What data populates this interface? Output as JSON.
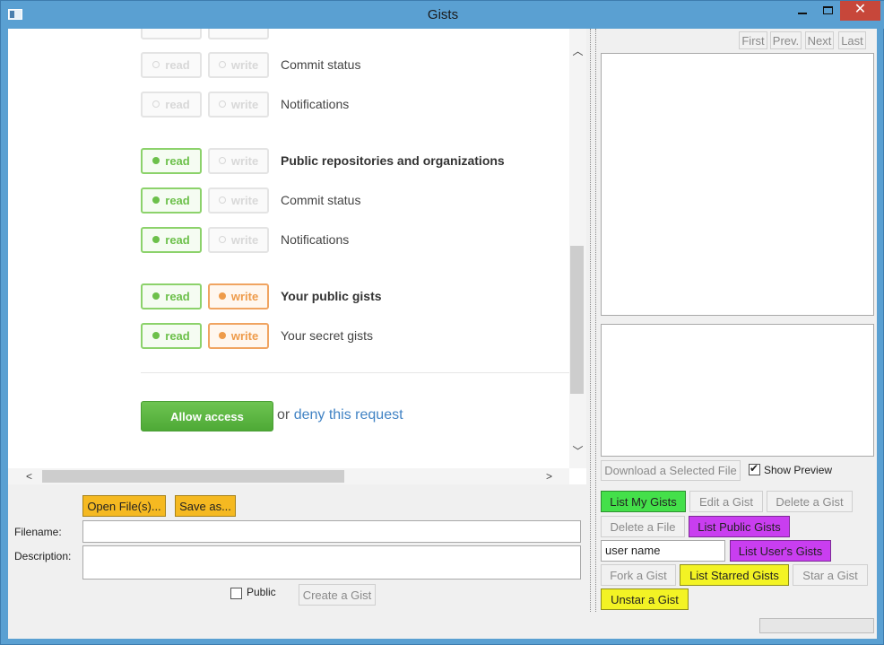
{
  "window": {
    "title": "Gists",
    "close_glyph": "✕"
  },
  "permissions": [
    {
      "read": "read",
      "write": "write",
      "read_on": false,
      "write_on": false,
      "label": "Commit status",
      "bold": false
    },
    {
      "read": "read",
      "write": "write",
      "read_on": false,
      "write_on": false,
      "label": "Notifications",
      "bold": false
    },
    {
      "read": "read",
      "write": "write",
      "read_on": true,
      "write_on": false,
      "label": "Public repositories and organizations",
      "bold": true
    },
    {
      "read": "read",
      "write": "write",
      "read_on": true,
      "write_on": false,
      "label": "Commit status",
      "bold": false
    },
    {
      "read": "read",
      "write": "write",
      "read_on": true,
      "write_on": false,
      "label": "Notifications",
      "bold": false
    },
    {
      "read": "read",
      "write": "write",
      "read_on": true,
      "write_on": true,
      "label": "Your public gists",
      "bold": true
    },
    {
      "read": "read",
      "write": "write",
      "read_on": true,
      "write_on": true,
      "label": "Your secret gists",
      "bold": false
    }
  ],
  "auth": {
    "allow_label": "Allow access",
    "or_text": "or",
    "deny_label": "deny this request"
  },
  "form": {
    "open_files": "Open File(s)...",
    "save_as": "Save as...",
    "filename_label": "Filename:",
    "description_label": "Description:",
    "public_label": "Public",
    "create_gist": "Create a Gist",
    "filename_value": "",
    "description_value": ""
  },
  "pager": {
    "first": "First",
    "prev": "Prev.",
    "next": "Next",
    "last": "Last"
  },
  "right": {
    "download_file": "Download a Selected File",
    "show_preview": "Show Preview",
    "list_my_gists": "List My Gists",
    "edit_gist": "Edit a Gist",
    "delete_gist": "Delete a Gist",
    "delete_file": "Delete a File",
    "list_public_gists": "List Public Gists",
    "user_name_value": "user name",
    "list_users_gists": "List User's Gists",
    "fork_gist": "Fork a Gist",
    "list_starred_gists": "List Starred Gists",
    "star_gist": "Star a Gist",
    "unstar_gist": "Unstar a Gist"
  },
  "colors": {
    "green": "#44e04a",
    "purple": "#c93ef0",
    "yellow": "#f3f324",
    "orange": "#f5b921",
    "link": "#4183c4"
  }
}
